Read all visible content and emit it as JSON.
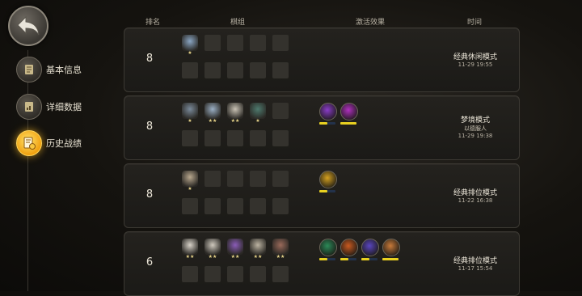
{
  "header": {
    "col_rank": "排名",
    "col_board": "棋组",
    "col_effects": "激活效果",
    "col_time": "时间"
  },
  "nav": [
    {
      "label": "基本信息",
      "icon": "scroll-icon"
    },
    {
      "label": "详细数据",
      "icon": "data-book-icon"
    },
    {
      "label": "历史战绩",
      "icon": "history-record-icon"
    }
  ],
  "colors": {
    "accent_gold": "#f0b020",
    "bar_yellow": "#e8d020",
    "panel": "#1f1d19"
  },
  "rows": [
    {
      "rank": "8",
      "mode": "经典休闲模式",
      "sub": "",
      "date": "11-29 19:55",
      "heroes": [
        {
          "stars": "★",
          "color": "#8aa6c4"
        }
      ],
      "effects": []
    },
    {
      "rank": "8",
      "mode": "梦境模式",
      "sub": "以德服人",
      "date": "11-29 19:38",
      "heroes": [
        {
          "stars": "★",
          "color": "#7a8a9a"
        },
        {
          "stars": "★★",
          "color": "#9bb0c6"
        },
        {
          "stars": "★★",
          "color": "#c9c2b4"
        },
        {
          "stars": "★",
          "color": "#4e7a6e"
        }
      ],
      "effects": [
        {
          "color": "#8a3cc8",
          "fill": 0.5
        },
        {
          "color": "#b030c0",
          "fill": 1.0
        }
      ]
    },
    {
      "rank": "8",
      "mode": "经典排位模式",
      "sub": "",
      "date": "11-22 16:38",
      "heroes": [
        {
          "stars": "★",
          "color": "#b9a88e"
        }
      ],
      "effects": [
        {
          "color": "#d4a020",
          "fill": 0.5
        }
      ]
    },
    {
      "rank": "6",
      "mode": "经典排位模式",
      "sub": "",
      "date": "11-17 15:54",
      "heroes": [
        {
          "stars": "★★",
          "color": "#d8d2c8"
        },
        {
          "stars": "★★",
          "color": "#cfc9be"
        },
        {
          "stars": "★★",
          "color": "#8a5cb8"
        },
        {
          "stars": "★★",
          "color": "#bdb4a2"
        },
        {
          "stars": "★★",
          "color": "#9a6a5a"
        }
      ],
      "effects": [
        {
          "color": "#2c8a58",
          "fill": 0.5
        },
        {
          "color": "#c85a20",
          "fill": 0.5
        },
        {
          "color": "#5a46c0",
          "fill": 0.5
        },
        {
          "color": "#c87a3a",
          "fill": 1.0
        }
      ]
    }
  ]
}
